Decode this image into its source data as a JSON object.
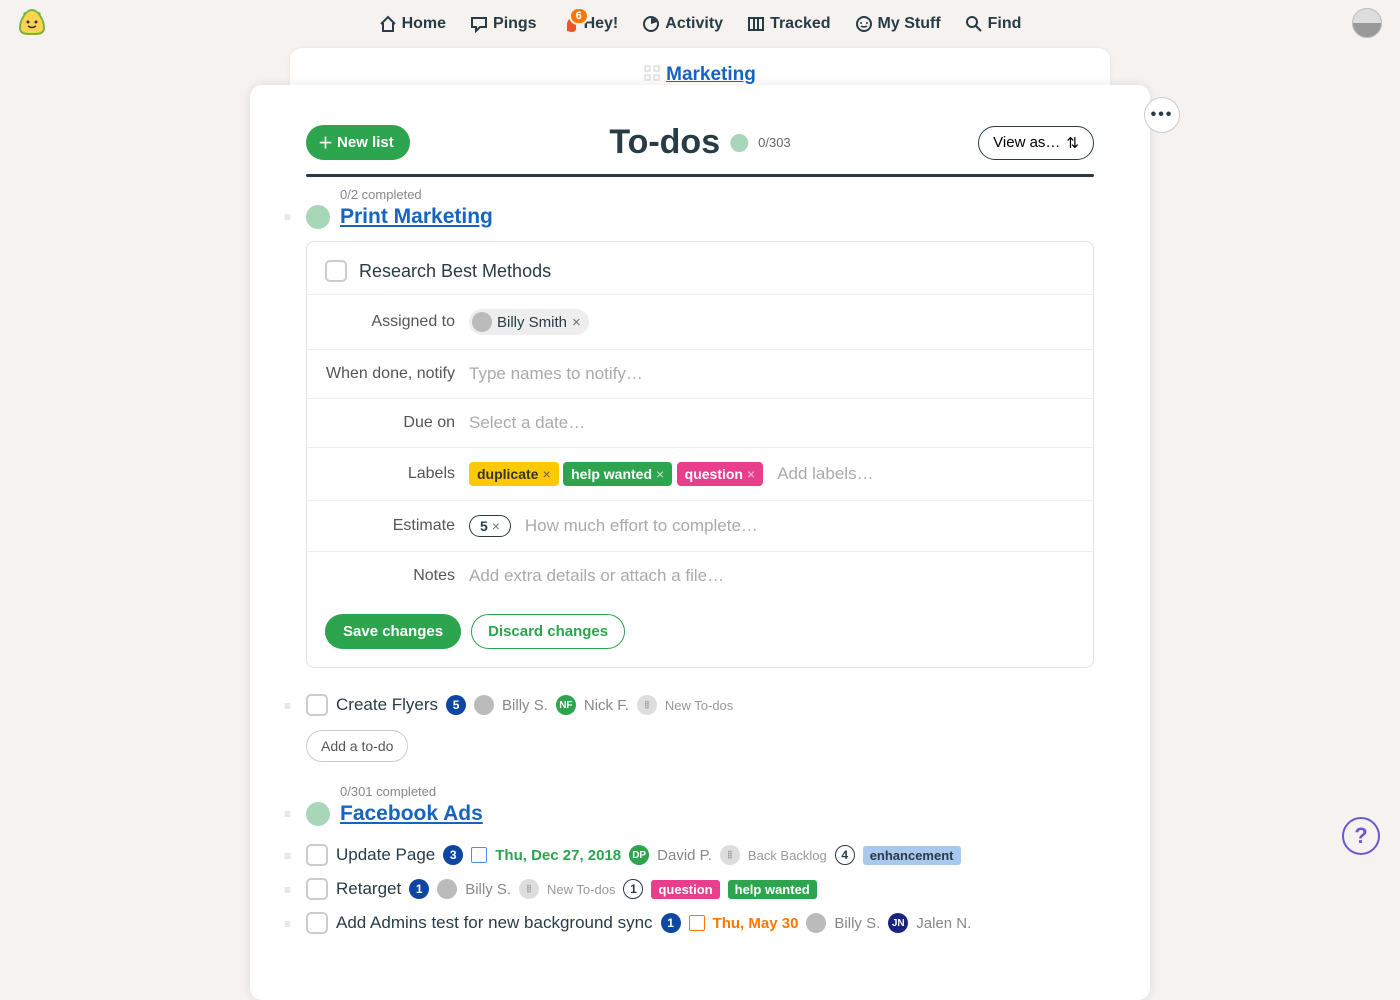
{
  "nav": {
    "home": "Home",
    "pings": "Pings",
    "hey": "Hey!",
    "hey_badge": "6",
    "activity": "Activity",
    "tracked": "Tracked",
    "mystuff": "My Stuff",
    "find": "Find"
  },
  "breadcrumb": "Marketing",
  "header": {
    "new_list": "New list",
    "title": "To-dos",
    "count": "0/303",
    "view_as": "View as…"
  },
  "lists": [
    {
      "completed": "0/2 completed",
      "title": "Print Marketing",
      "editing": {
        "title": "Research Best Methods",
        "labels": {
          "assigned": "Assigned to",
          "notify": "When done, notify",
          "due": "Due on",
          "labels": "Labels",
          "estimate": "Estimate",
          "notes": "Notes"
        },
        "assignee": "Billy Smith",
        "notify_placeholder": "Type names to notify…",
        "due_placeholder": "Select a date…",
        "tags": [
          {
            "text": "duplicate",
            "cls": "label-yellow"
          },
          {
            "text": "help wanted",
            "cls": "label-green"
          },
          {
            "text": "question",
            "cls": "label-pink"
          }
        ],
        "labels_placeholder": "Add labels…",
        "estimate_value": "5",
        "estimate_placeholder": "How much effort to complete…",
        "notes_placeholder": "Add extra details or attach a file…",
        "save": "Save changes",
        "discard": "Discard changes"
      },
      "items": [
        {
          "title": "Create Flyers",
          "badge": "5",
          "assignees": [
            {
              "name": "Billy S.",
              "avatar": true
            },
            {
              "name": "Nick F.",
              "initials": "NF",
              "cls": "ic-green"
            }
          ],
          "stage": "New To-dos"
        }
      ],
      "add_label": "Add a to-do"
    },
    {
      "completed": "0/301 completed",
      "title": "Facebook Ads",
      "items": [
        {
          "title": "Update Page",
          "badge": "3",
          "date": "Thu, Dec 27, 2018",
          "date_cls": "date-txt",
          "cal_cls": "cal-icon",
          "assignees": [
            {
              "name": "David P.",
              "initials": "DP",
              "cls": "ic-green"
            }
          ],
          "stage": "Back Backlog",
          "outline_badge": "4",
          "pill": {
            "text": "enhancement",
            "cls": "pill-blue"
          }
        },
        {
          "title": "Retarget",
          "badge": "1",
          "assignees": [
            {
              "name": "Billy S.",
              "avatar": true
            }
          ],
          "stage": "New To-dos",
          "outline_badge": "1",
          "pills": [
            {
              "text": "question",
              "cls": "pill-pink"
            },
            {
              "text": "help wanted",
              "cls": "pill-green"
            }
          ]
        },
        {
          "title": "Add Admins test for new background sync",
          "badge": "1",
          "date": "Thu, May 30",
          "date_cls": "date-orange",
          "cal_cls": "cal-icon cal-icon-o",
          "assignees": [
            {
              "name": "Billy S.",
              "avatar": true
            },
            {
              "name": "Jalen N.",
              "initials": "JN",
              "cls": "ic-navy"
            }
          ]
        }
      ]
    }
  ]
}
